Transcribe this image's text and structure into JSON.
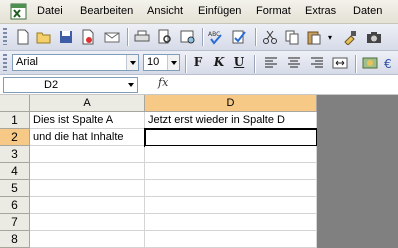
{
  "menu": [
    "Datei",
    "Bearbeiten",
    "Ansicht",
    "Einfügen",
    "Format",
    "Extras",
    "Daten"
  ],
  "standard_toolbar": {
    "icons": [
      "new-icon",
      "open-icon",
      "save-icon",
      "permission-icon",
      "mail-icon",
      "print-icon",
      "print-preview-icon",
      "research-icon",
      "spelling-icon",
      "check-icon",
      "cut-icon",
      "copy-icon",
      "paste-icon",
      "format-painter-icon",
      "camera-icon"
    ]
  },
  "formatting_toolbar": {
    "font": "Arial",
    "size": "10",
    "bold": "F",
    "italic": "K",
    "underline": "U"
  },
  "formula_bar": {
    "name_box": "D2",
    "fx": "fx",
    "formula": ""
  },
  "sheet": {
    "columns": [
      "A",
      "D"
    ],
    "active_column": "D",
    "rows": [
      "1",
      "2",
      "3",
      "4",
      "5",
      "6",
      "7",
      "8"
    ],
    "active_row": "2",
    "cells": {
      "A1": "Dies ist Spalte A",
      "D1": "Jetzt erst wieder in Spalte D",
      "A2": "und die hat Inhalte",
      "D2": ""
    },
    "selected_cell": "D2"
  },
  "colors": {
    "header_active": "#f7c986",
    "header": "#ecebe3",
    "outside_area": "#808080"
  }
}
